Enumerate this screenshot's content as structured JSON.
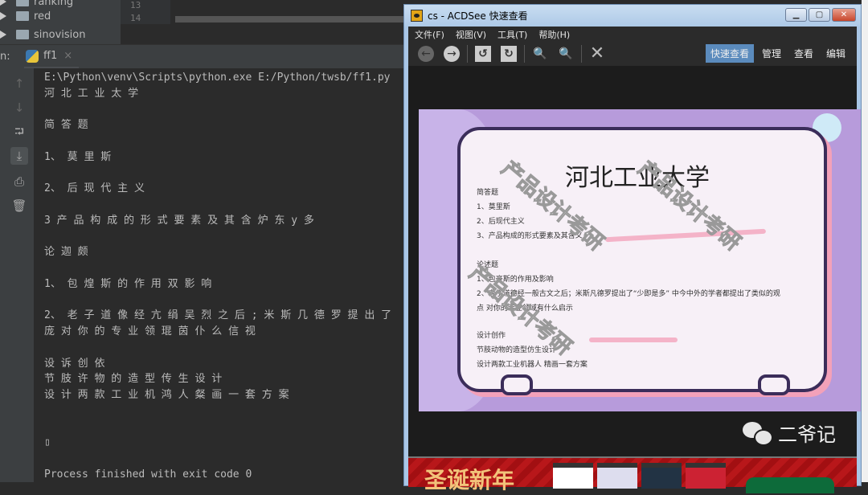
{
  "project_tree": {
    "items": [
      "ranking",
      "red",
      "sinovision"
    ]
  },
  "editor": {
    "line_numbers": [
      "13",
      "14"
    ]
  },
  "run_panel": {
    "label": "n:",
    "tab_name": "ff1",
    "close": "×"
  },
  "console": {
    "lines": [
      "E:\\Python\\venv\\Scripts\\python.exe E:/Python/twsb/ff1.py",
      "河 北 工 业 太 学",
      "",
      "简 答 题",
      "",
      "1、 莫 里 斯",
      "",
      "2、 后 现 代 主 义",
      "",
      "3 产 品 构 成 的 形 式 要 素 及 其 含 炉 东 y 多",
      "",
      "论 迦 颇",
      "",
      "1、 包 煌 斯 的 作 用 双 影 响",
      "",
      "2、 老 子 道 像 经 亢 绢 吴 烈 之 后 ; 米 斯 几 德 罗 提 出 了",
      "庞 对 你 的 专 业 领 琨 茵 仆 么 信 视",
      "",
      "设 诉 创 依",
      "节 肢 许 物 的 造 型 传 生 设 计",
      "设 计 两 款 工 业 机 鸿 人 粲 画 一 套 方 案",
      "",
      "",
      "▯",
      "",
      "Process finished with exit code 0"
    ]
  },
  "acdsee": {
    "title": "cs - ACDSee 快速查看",
    "menu": [
      "文件(F)",
      "视图(V)",
      "工具(T)",
      "帮助(H)"
    ],
    "modes": [
      "快速查看",
      "管理",
      "查看",
      "编辑"
    ],
    "image": {
      "title": "河北工业大学",
      "lines": [
        "简答题",
        "1、莫里斯",
        "2、后现代主义",
        "3、产品构成的形式要素及其含义",
        "论述题",
        "1、包豪斯的作用及影响",
        "2、老子道德经一般古文之后；米斯凡德罗提出了“少即是多” 中今中外的学者都提出了类似的观",
        "点 对你的专业领域有什么启示",
        "设计创作",
        "节肢动物的造型仿生设计",
        "设计两款工业机器人 精画一套方案"
      ],
      "watermark": "产品设计考研"
    },
    "wechat_name": "二爷记",
    "banner_text": "圣诞新年"
  }
}
